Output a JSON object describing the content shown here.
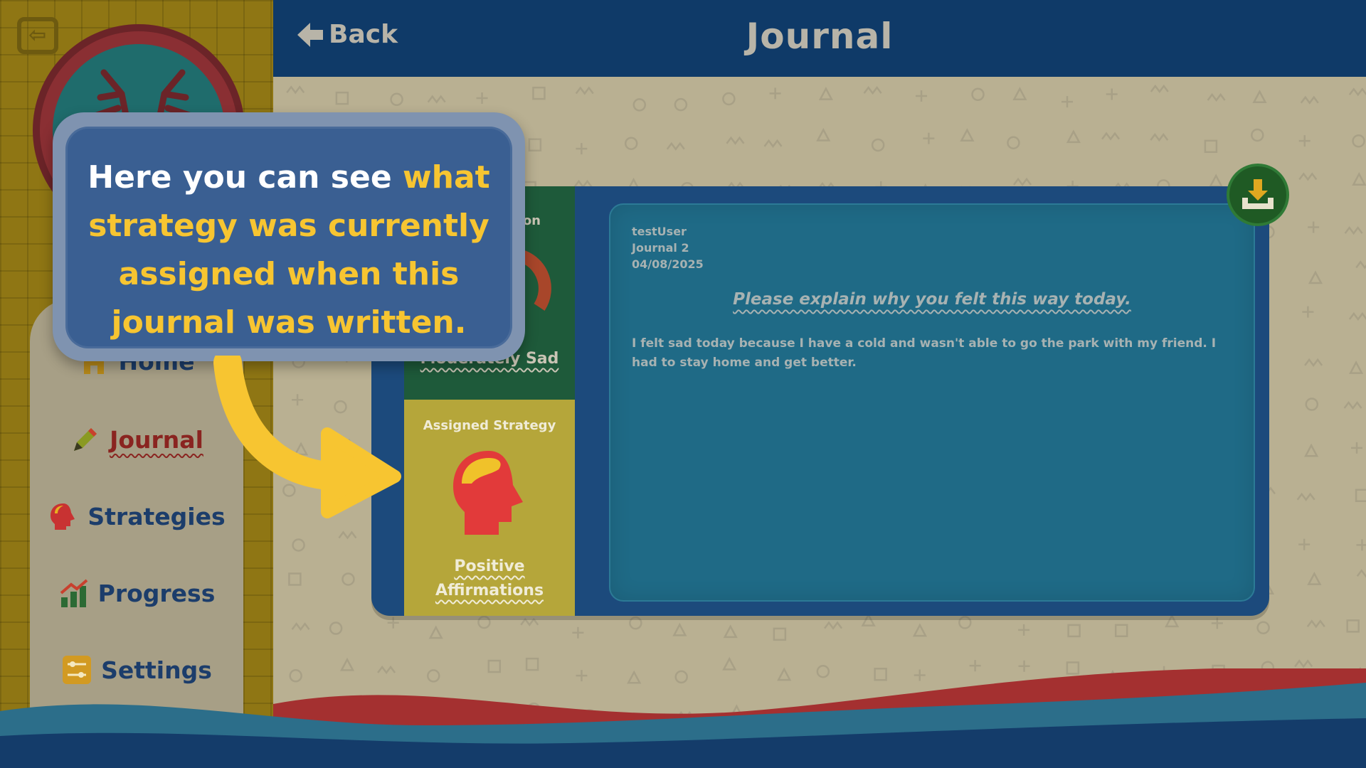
{
  "header": {
    "back_label": "Back",
    "title": "Journal"
  },
  "sidebar": {
    "items": [
      {
        "label": "Home",
        "icon": "house-icon",
        "active": false
      },
      {
        "label": "Journal",
        "icon": "pencil-icon",
        "active": true
      },
      {
        "label": "Strategies",
        "icon": "head-icon",
        "active": false
      },
      {
        "label": "Progress",
        "icon": "chart-icon",
        "active": false
      },
      {
        "label": "Settings",
        "icon": "sliders-icon",
        "active": false
      }
    ]
  },
  "journal": {
    "emotion_label_partial": "on",
    "emotion_value": "Moderately Sad",
    "strategy_heading": "Assigned Strategy",
    "strategy_name": "Positive Affirmations",
    "user": "testUser",
    "journal_name": "Journal 2",
    "date": "04/08/2025",
    "question": "Please explain why you felt this way today.",
    "entry": "I felt sad today because I have a cold and wasn't able to go the park with my friend. I had to stay home and get better."
  },
  "tooltip": {
    "text_plain": "Here you can see ",
    "text_highlight": "what strategy was currently assigned when this journal was written."
  },
  "colors": {
    "header": "#0f3a68",
    "highlight": "#f7c531",
    "strategy_icon": "#e84040",
    "download_button": "#1f5a24"
  }
}
